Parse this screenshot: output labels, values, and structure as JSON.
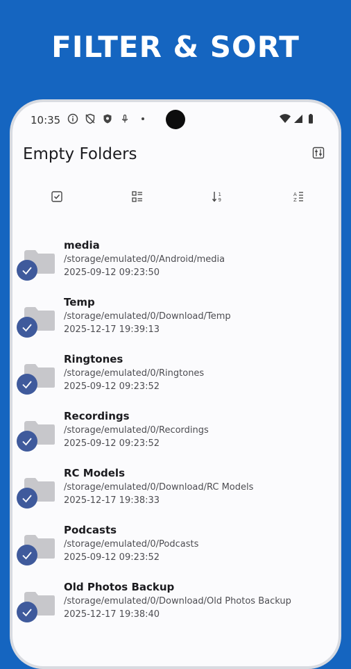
{
  "banner": {
    "title": "FILTER & SORT"
  },
  "status_bar": {
    "time": "10:35",
    "left_icons": [
      "info-icon",
      "shield-off-icon",
      "shield-icon",
      "mic-icon",
      "dot-icon"
    ],
    "right_icons": [
      "wifi-icon",
      "signal-icon",
      "battery-icon"
    ]
  },
  "app_bar": {
    "title": "Empty Folders",
    "action_icon": "tune-icon"
  },
  "toolbar": {
    "items": [
      {
        "icon": "select-all-icon"
      },
      {
        "icon": "list-view-icon"
      },
      {
        "icon": "sort-numeric-icon"
      },
      {
        "icon": "sort-alpha-icon"
      }
    ]
  },
  "folders": [
    {
      "name": "media",
      "path": "/storage/emulated/0/Android/media",
      "date": "2025-09-12 09:23:50",
      "checked": true
    },
    {
      "name": "Temp",
      "path": "/storage/emulated/0/Download/Temp",
      "date": "2025-12-17 19:39:13",
      "checked": true
    },
    {
      "name": "Ringtones",
      "path": "/storage/emulated/0/Ringtones",
      "date": "2025-09-12 09:23:52",
      "checked": true
    },
    {
      "name": "Recordings",
      "path": "/storage/emulated/0/Recordings",
      "date": "2025-09-12 09:23:52",
      "checked": true
    },
    {
      "name": "RC Models",
      "path": "/storage/emulated/0/Download/RC Models",
      "date": "2025-12-17 19:38:33",
      "checked": true
    },
    {
      "name": "Podcasts",
      "path": "/storage/emulated/0/Podcasts",
      "date": "2025-09-12 09:23:52",
      "checked": true
    },
    {
      "name": "Old Photos Backup",
      "path": "/storage/emulated/0/Download/Old Photos Backup",
      "date": "2025-12-17 19:38:40",
      "checked": true
    }
  ],
  "colors": {
    "background": "#1565c0",
    "check": "#3f5a9c",
    "folder": "#c7c7cb"
  }
}
